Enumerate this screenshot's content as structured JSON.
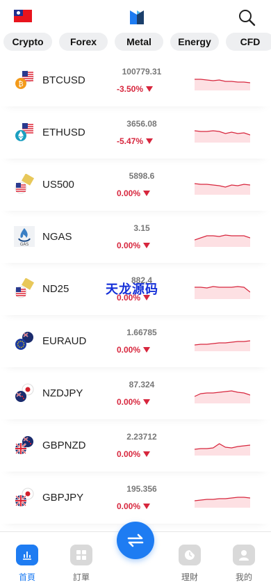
{
  "header": {
    "flag_icon": "taiwan-flag-icon",
    "logo_icon": "brand-logo-icon",
    "search_icon": "search-icon"
  },
  "tabs": [
    {
      "label": "Crypto"
    },
    {
      "label": "Forex"
    },
    {
      "label": "Metal"
    },
    {
      "label": "Energy"
    },
    {
      "label": "CFD"
    }
  ],
  "rows": [
    {
      "symbol": "BTCUSD",
      "price": "100779.31",
      "change": "-3.50%",
      "icon": "bitcoin-usd-icon",
      "trend": [
        6,
        6,
        7,
        8,
        7,
        9,
        9,
        10,
        10,
        11
      ]
    },
    {
      "symbol": "ETHUSD",
      "price": "3656.08",
      "change": "-5.47%",
      "icon": "ethereum-usd-icon",
      "trend": [
        5,
        6,
        6,
        5,
        6,
        9,
        7,
        9,
        8,
        11
      ]
    },
    {
      "symbol": "US500",
      "price": "5898.6",
      "change": "0.00%",
      "icon": "us500-index-icon",
      "trend": [
        6,
        7,
        7,
        8,
        9,
        11,
        8,
        9,
        7,
        8
      ]
    },
    {
      "symbol": "NGAS",
      "price": "3.15",
      "change": "0.00%",
      "icon": "natural-gas-icon",
      "trend": [
        12,
        9,
        6,
        6,
        7,
        5,
        6,
        6,
        6,
        9
      ]
    },
    {
      "symbol": "ND25",
      "price": "882.4",
      "change": "0.00%",
      "icon": "nasdaq-index-icon",
      "trend": [
        5,
        5,
        6,
        4,
        5,
        5,
        5,
        4,
        5,
        12
      ]
    },
    {
      "symbol": "EURAUD",
      "price": "1.66785",
      "change": "0.00%",
      "icon": "euro-aud-icon",
      "trend": [
        13,
        12,
        12,
        11,
        10,
        10,
        9,
        8,
        8,
        7
      ]
    },
    {
      "symbol": "NZDJPY",
      "price": "87.324",
      "change": "0.00%",
      "icon": "nzd-jpy-icon",
      "trend": [
        12,
        8,
        7,
        7,
        6,
        5,
        4,
        6,
        7,
        10
      ]
    },
    {
      "symbol": "GBPNZD",
      "price": "2.23712",
      "change": "0.00%",
      "icon": "gbp-nzd-icon",
      "trend": [
        13,
        12,
        12,
        11,
        5,
        10,
        11,
        9,
        8,
        7
      ]
    },
    {
      "symbol": "GBPJPY",
      "price": "195.356",
      "change": "0.00%",
      "icon": "gbp-jpy-icon",
      "trend": [
        12,
        11,
        10,
        10,
        9,
        9,
        8,
        7,
        7,
        8
      ]
    }
  ],
  "watermark": "天龙源码",
  "colors": {
    "accent": "#1e7cf2",
    "negative": "#d7263d",
    "spark_fill": "#fde0e3"
  },
  "nav": [
    {
      "label": "首頁",
      "icon": "chart-bars-icon",
      "active": true
    },
    {
      "label": "訂單",
      "icon": "grid-icon",
      "active": false
    },
    {
      "label": "理財",
      "icon": "clock-icon",
      "active": false
    },
    {
      "label": "我的",
      "icon": "user-icon",
      "active": false
    }
  ],
  "fab": {
    "icon": "swap-arrows-icon"
  }
}
